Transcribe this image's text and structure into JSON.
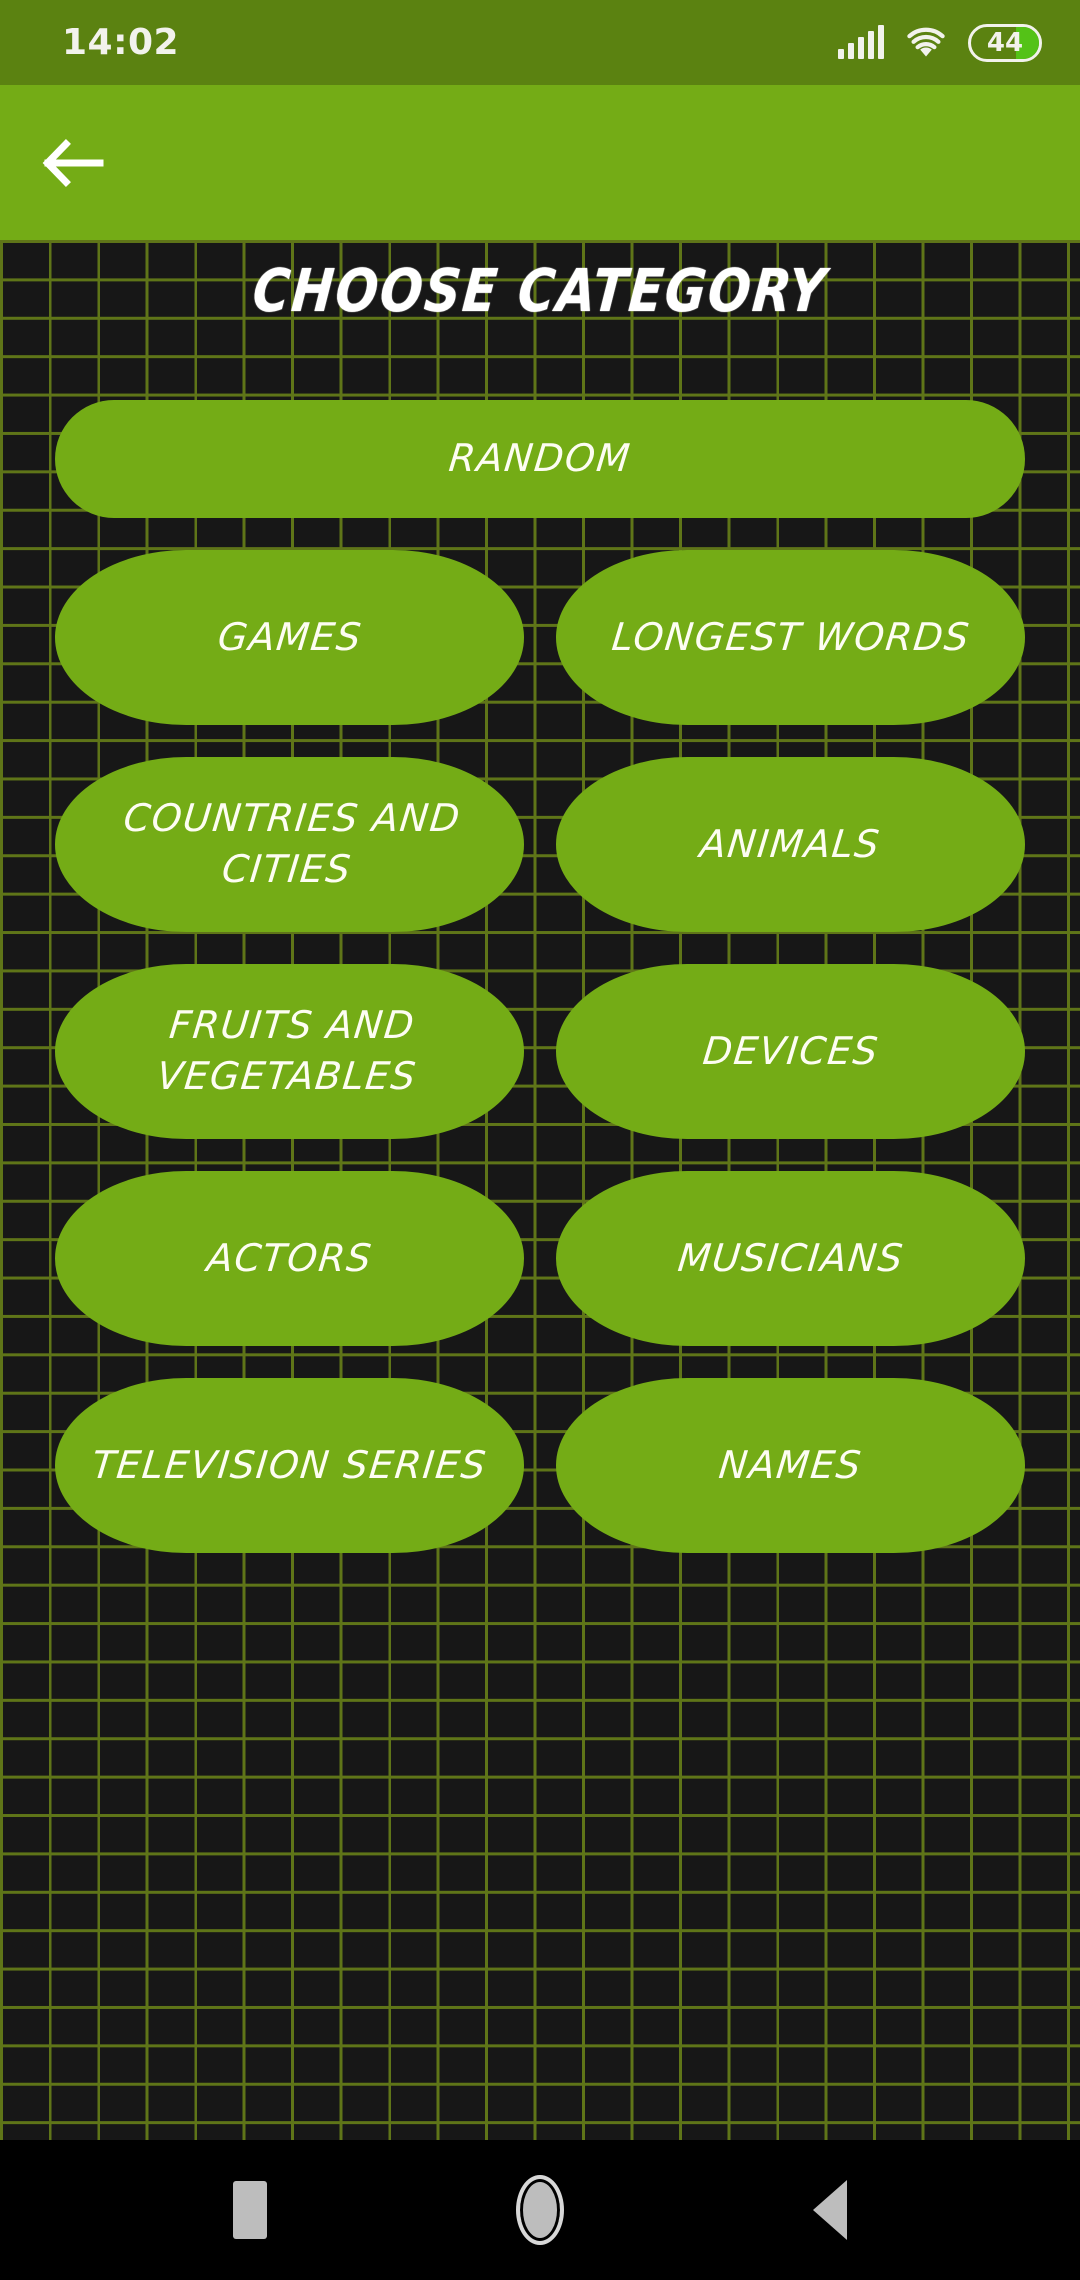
{
  "status_bar": {
    "clock": "14:02",
    "battery_level": "44",
    "signal_icon": "signal-bars-icon",
    "wifi_icon": "wifi-icon",
    "battery_icon": "battery-icon",
    "bg_color": "#5b8211"
  },
  "app_bar": {
    "back_icon": "back-arrow-icon",
    "bg_color": "#74ac16"
  },
  "page": {
    "title": "CHOOSE CATEGORY",
    "bg_color": "#171717",
    "grid_line_color": "#5f7518",
    "accent_color": "#74ac16"
  },
  "categories": {
    "featured": {
      "label": "RANDOM"
    },
    "rows": [
      [
        {
          "label": "GAMES"
        },
        {
          "label": "LONGEST WORDS"
        }
      ],
      [
        {
          "label": "COUNTRIES AND CITIES"
        },
        {
          "label": "ANIMALS"
        }
      ],
      [
        {
          "label": "FRUITS AND VEGETABLES"
        },
        {
          "label": "DEVICES"
        }
      ],
      [
        {
          "label": "ACTORS"
        },
        {
          "label": "MUSICIANS"
        }
      ],
      [
        {
          "label": "TELEVISION SERIES"
        },
        {
          "label": "NAMES"
        }
      ]
    ]
  },
  "nav_bar": {
    "recents_icon": "square-recents-icon",
    "home_icon": "circle-home-icon",
    "back_icon": "triangle-back-icon",
    "bg_color": "#000000"
  }
}
